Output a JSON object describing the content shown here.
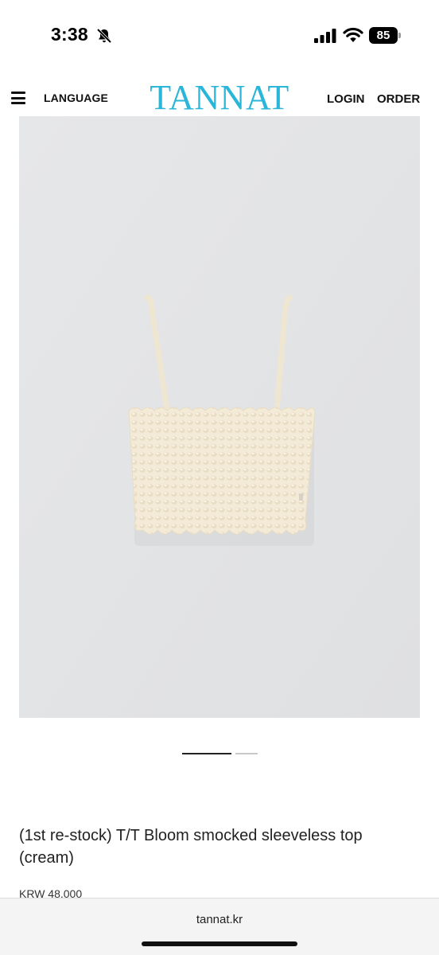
{
  "status_bar": {
    "time": "3:38",
    "battery_level": "85",
    "icons": [
      "bell-muted-icon",
      "cellular-signal-icon",
      "wifi-icon",
      "battery-icon"
    ]
  },
  "header": {
    "menu_icon": "hamburger-menu-icon",
    "language_label": "LANGUAGE",
    "brand": "TANNAT",
    "brand_color": "#29b6d8",
    "login_label": "LOGIN",
    "order_label": "ORDER"
  },
  "product": {
    "image_description": "cream smocked sleeveless top",
    "title": "(1st re-stock) T/T Bloom smocked sleeveless top (cream)",
    "price": "KRW 48,000"
  },
  "carousel": {
    "slide_count": 2,
    "active_index": 0
  },
  "browser": {
    "url": "tannat.kr"
  }
}
